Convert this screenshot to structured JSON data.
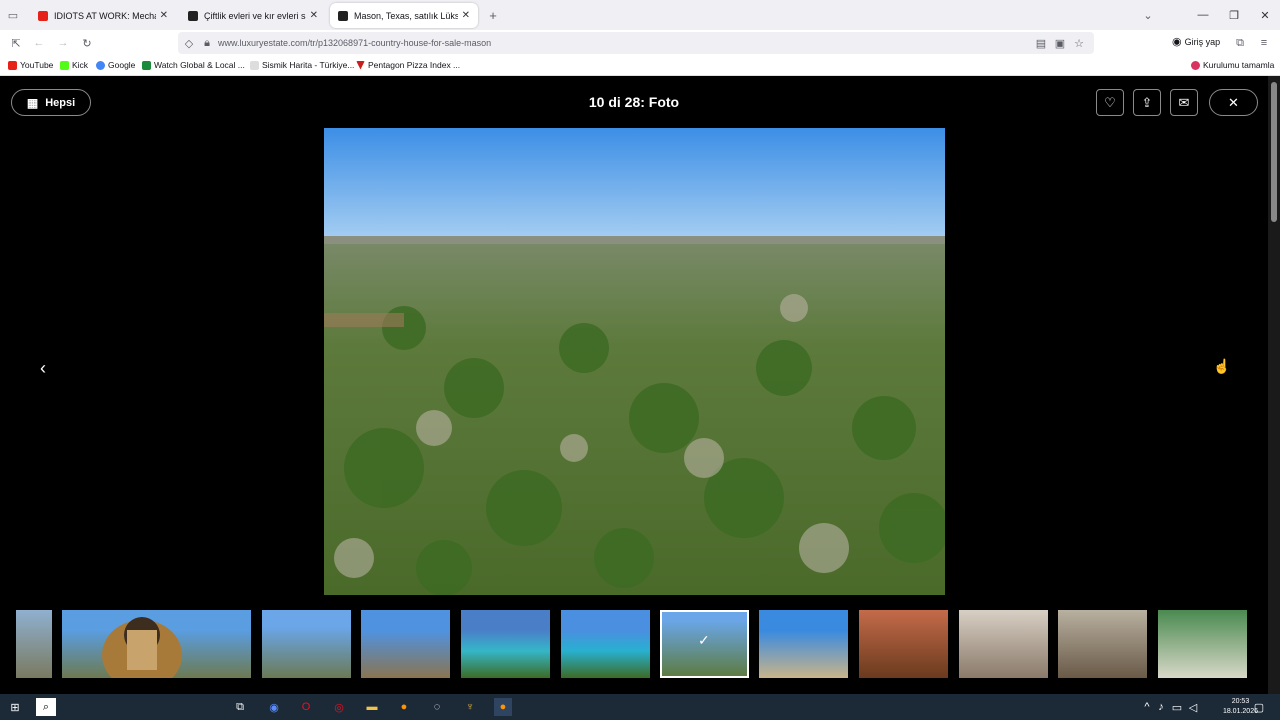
{
  "tabs": [
    {
      "title": "IDIOTS AT WORK: Mechanic Edi",
      "fav_color": "#e62117"
    },
    {
      "title": "Çiftlik evleri ve kır evleri satılık A",
      "fav_color": "#222"
    },
    {
      "title": "Mason, Texas, satılık Lüks Köy e",
      "fav_color": "#222",
      "active": true
    }
  ],
  "new_tab": "+",
  "url": "www.luxuryestate.com/tr/p132068971-country-house-for-sale-mason",
  "login_label": "Giriş yap",
  "bookmarks": [
    {
      "label": "YouTube",
      "color": "#e62117"
    },
    {
      "label": "Kick",
      "color": "#53fc18"
    },
    {
      "label": "Google",
      "color": "#4285f4"
    },
    {
      "label": "Watch Global & Local ...",
      "color": "#1b8a3a"
    },
    {
      "label": "Sismik Harita - Türkiye...",
      "color": "#ccc"
    },
    {
      "label": "Pentagon Pizza Index ...",
      "color": "#c81e1e"
    },
    {
      "label": "Kurulumu tamamla",
      "color": "#d8345f"
    }
  ],
  "gallery": {
    "all_label": "Hepsi",
    "title": "10 di 28: Foto"
  },
  "clock": {
    "time": "20:53",
    "date": "18.01.2026"
  },
  "colors": {
    "accent": "#0060df",
    "background": "#000000"
  }
}
